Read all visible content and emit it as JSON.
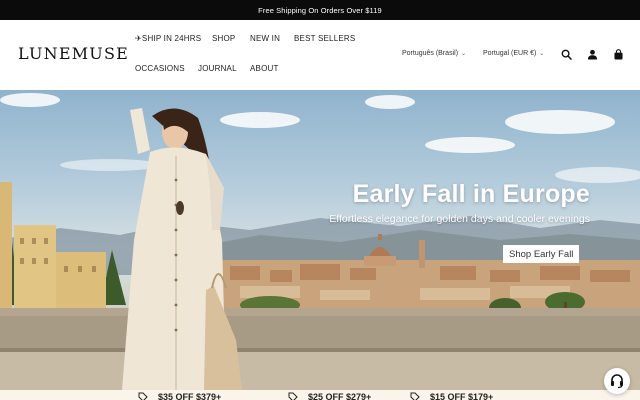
{
  "announcement": {
    "text": "Free Shipping On Orders Over $119"
  },
  "header": {
    "logo": "LUNEMUSE",
    "nav": [
      {
        "label": "✈SHIP IN 24HRS"
      },
      {
        "label": "SHOP"
      },
      {
        "label": "NEW IN"
      },
      {
        "label": "BEST SELLERS"
      },
      {
        "label": "OCCASIONS"
      },
      {
        "label": "JOURNAL"
      },
      {
        "label": "ABOUT"
      }
    ],
    "language": "Português (Brasil)",
    "region": "Portugal (EUR €)",
    "icons": [
      "search-icon",
      "account-icon",
      "cart-icon"
    ]
  },
  "hero": {
    "title": "Early Fall in Europe",
    "subtitle": "Effortless elegance for golden days and cooler evenings",
    "cta": "Shop Early Fall"
  },
  "promos": [
    {
      "icon": "tag-icon",
      "text": "$35 OFF $379+"
    },
    {
      "icon": "tag-icon",
      "text": "$25 OFF $279+"
    },
    {
      "icon": "tag-icon",
      "text": "$15 OFF $179+"
    }
  ],
  "support": {
    "icon": "headset-icon"
  },
  "colors": {
    "announcement_bg": "#0b0b0b",
    "promo_bg": "#fbf4ea",
    "cta_bg": "#ffffff"
  }
}
